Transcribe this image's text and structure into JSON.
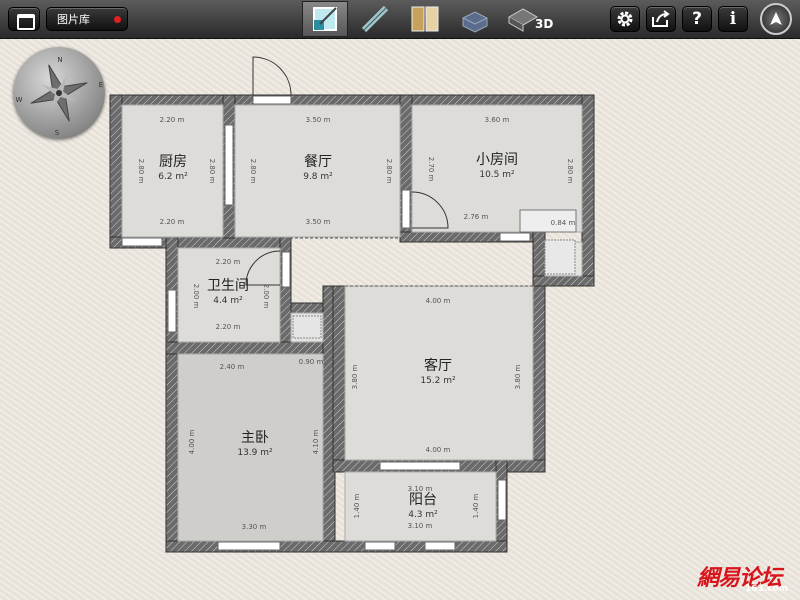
{
  "toolbar": {
    "gallery_label": "图片库",
    "tool_3d_label": "3D",
    "help_label": "?",
    "info_label": "i"
  },
  "compass": {
    "n": "N",
    "s": "S",
    "e": "E",
    "w": "W"
  },
  "rooms": {
    "kitchen": {
      "name": "厨房",
      "area": "6.2 m²"
    },
    "dining": {
      "name": "餐厅",
      "area": "9.8 m²"
    },
    "small": {
      "name": "小房间",
      "area": "10.5 m²"
    },
    "bath": {
      "name": "卫生间",
      "area": "4.4 m²"
    },
    "living": {
      "name": "客厅",
      "area": "15.2 m²"
    },
    "master": {
      "name": "主卧",
      "area": "13.9 m²"
    },
    "balcony": {
      "name": "阳台",
      "area": "4.3 m²"
    }
  },
  "dims": {
    "k_top": "2.20 m",
    "k_bot": "2.20 m",
    "k_left": "2.80 m",
    "k_right": "2.80 m",
    "d_top": "3.50 m",
    "d_bot": "3.50 m",
    "d_left": "2.80 m",
    "d_right": "2.80 m",
    "s_top": "3.60 m",
    "s_left": "2.70 m",
    "s_right": "2.80 m",
    "s_mid": "2.76 m",
    "s_side": "0.84 m",
    "b_top": "2.20 m",
    "b_bot": "2.20 m",
    "b_left": "2.00 m",
    "b_right": "2.00 m",
    "l_top": "4.00 m",
    "l_bot": "4.00 m",
    "l_left": "3.80 m",
    "l_right": "3.80 m",
    "m_top": "2.40 m",
    "m_bot": "3.30 m",
    "m_left": "4.00 m",
    "m_right": "4.10 m",
    "m_small": "0.90 m",
    "bal_top": "3.10 m",
    "bal_bot": "3.10 m",
    "bal_left": "1.40 m",
    "bal_right": "1.40 m"
  },
  "watermark": {
    "brand": "網易论坛",
    "sub": "163.com"
  },
  "colors": {
    "wall": "#4a4a4a",
    "floor": "#dcdbd7",
    "hatch": "#8a8a8a",
    "toolbar": "#2a2a2a"
  }
}
